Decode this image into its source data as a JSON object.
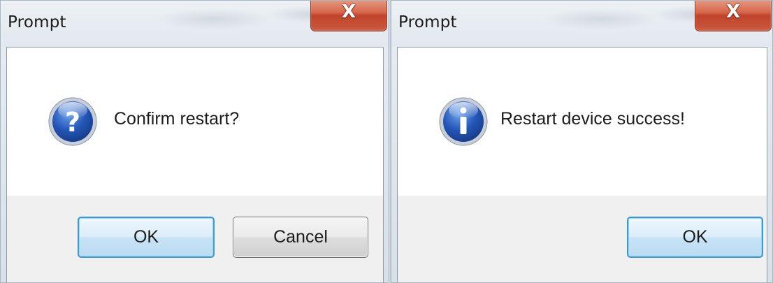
{
  "dialogs": [
    {
      "title": "Prompt",
      "close_label": "X",
      "icon": "question-icon",
      "message": "Confirm restart?",
      "buttons": [
        "OK",
        "Cancel"
      ]
    },
    {
      "title": "Prompt",
      "close_label": "X",
      "icon": "info-icon",
      "message": "Restart device success!",
      "buttons": [
        "OK"
      ]
    }
  ],
  "colors": {
    "default_button_border": "#3c9ad3",
    "close_button": "#c0432a",
    "icon_blue": "#1f4fa8"
  }
}
